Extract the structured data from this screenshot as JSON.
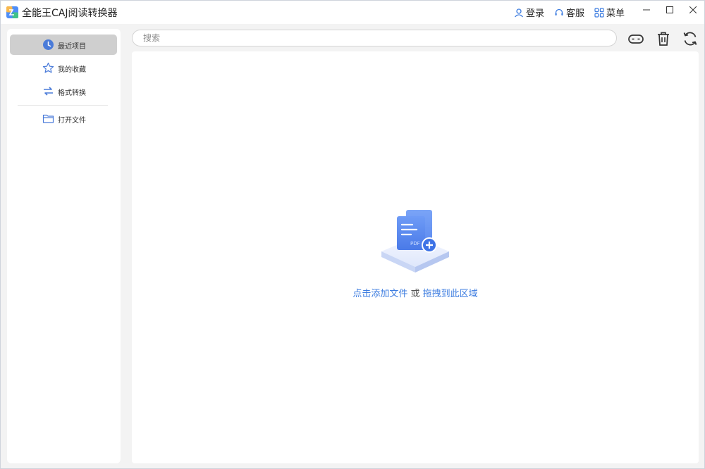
{
  "app": {
    "title": "全能王CAJ阅读转换器"
  },
  "header": {
    "login_label": "登录",
    "service_label": "客服",
    "menu_label": "菜单"
  },
  "sidebar": {
    "items": [
      {
        "label": "最近项目",
        "icon": "clock-icon",
        "active": true
      },
      {
        "label": "我的收藏",
        "icon": "star-icon",
        "active": false
      },
      {
        "label": "格式转换",
        "icon": "convert-arrows-icon",
        "active": false
      },
      {
        "label": "打开文件",
        "icon": "folder-icon",
        "active": false
      }
    ]
  },
  "search": {
    "placeholder": "搜索",
    "value": ""
  },
  "toolbar": {
    "icons": [
      "gamepad-icon",
      "trash-icon",
      "refresh-icon"
    ]
  },
  "dropzone": {
    "click_link": "点击添加文件",
    "connector": " 或 ",
    "drag_link": "拖拽到此区域",
    "illustration_badge": "PDF"
  },
  "colors": {
    "accent": "#3c7ce0",
    "sidebar_icon": "#4a7bd9",
    "active_item_bg": "#cfcfcf"
  }
}
